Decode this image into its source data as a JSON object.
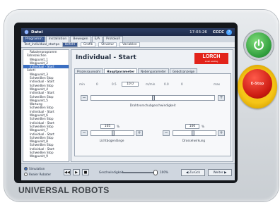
{
  "hardware": {
    "brand": "UNIVERSAL ROBOTS",
    "estop_label": "E-Stop"
  },
  "topbar": {
    "title": "Datei",
    "clock": "17:03:26",
    "indicator": "CCCC",
    "help": "?"
  },
  "tabs": [
    "Programm",
    "Installation",
    "Bewegen",
    "E/A",
    "Protokoll"
  ],
  "active_tab": "Programm",
  "filebar": {
    "file": "Test_individual_startpo",
    "subtabs": [
      "Befehl",
      "Grafik",
      "Struktur",
      "Variablen"
    ],
    "active_subtab": "Befehl"
  },
  "tree": [
    "Roboterprogramm",
    "Fahrezeichen",
    "Wegpunkt_1",
    "Wegpunkt_2",
    "Individual - Start",
    "Fahrtl",
    "Wegpunkt_3",
    "Schweißen Stop",
    "Individual - Start",
    "Schweißen Stop",
    "Wegpunkt_4",
    "Individual - Start",
    "Schweißen Stop",
    "Wegpunkt_5",
    "Wartung",
    "Schweißen Stop",
    "Individual - Start",
    "Wegpunkt_6",
    "Schweißen Stop",
    "Individual - Start",
    "Schweißen Stop",
    "Wegpunkt_7",
    "Individual - Start",
    "Schweißen Stop",
    "Wegpunkt_8",
    "Schweißen Stop",
    "Individual - Start",
    "Schweißen Stop",
    "Wegpunkt_9"
  ],
  "selected_tree_index": 4,
  "content": {
    "title": "Individual - Start",
    "logo": {
      "name": "LORCH",
      "tagline": "smart welding"
    },
    "param_tabs": [
      "Prozessauswahl",
      "Hauptparameter",
      "Nebenparameter",
      "Gebotsanzeige"
    ],
    "active_param_tab": "Hauptparameter",
    "wire_speed": {
      "scale": [
        "min",
        "0",
        "0.5",
        "10.0",
        "m/min",
        "0.0",
        "0",
        "max"
      ],
      "value": "10.0",
      "unit": "m/min",
      "level": 0.5,
      "caption": "Drahtvorschubgeschwindigkeit"
    },
    "arc_length": {
      "value": "105",
      "unit": "%",
      "level": 0.5,
      "caption": "Lichtbogenlänge"
    },
    "dynamics": {
      "value": "100",
      "unit": "%",
      "level": 0.45,
      "caption": "Drosselwirkung"
    }
  },
  "bottom": {
    "simulation": "Simulation",
    "real_robot": "Realer Roboter",
    "mode": "Simulation",
    "controls": [
      "◀◀",
      "▶",
      "■"
    ],
    "speed_label": "Geschwindigkeit",
    "speed_value": "100%",
    "speed_level": 1.0,
    "back": "◀ Zurück",
    "next": "Weiter ▶"
  },
  "colors": {
    "accent": "#3b5a94",
    "selected": "#3b6fc2",
    "lorch_red": "#e2231a",
    "power": "#2e9c3b",
    "estop": "#cc1b12"
  }
}
